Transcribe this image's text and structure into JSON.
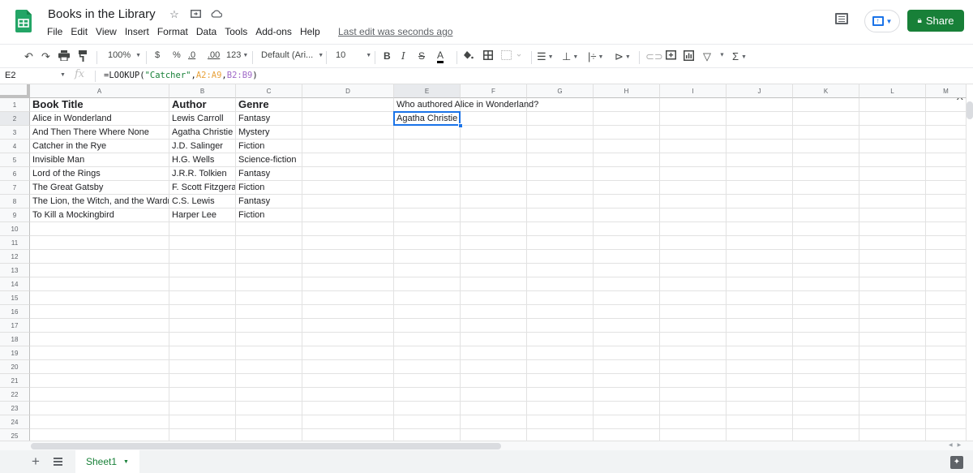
{
  "app": {
    "title": "Books in the Library",
    "last_edit": "Last edit was seconds ago",
    "share_label": "Share",
    "title_icons": [
      "star-icon",
      "move-to-folder-icon",
      "cloud-status-icon"
    ]
  },
  "menu": [
    "File",
    "Edit",
    "View",
    "Insert",
    "Format",
    "Data",
    "Tools",
    "Add-ons",
    "Help"
  ],
  "toolbar": {
    "zoom": "100%",
    "currency": "$",
    "percent": "%",
    "decrease_decimal": ".0",
    "increase_decimal": ".00",
    "more_formats": "123",
    "font": "Default (Ari...",
    "font_size": "10",
    "bold": "B",
    "italic": "I",
    "strike": "S",
    "text_color": "A"
  },
  "formula_bar": {
    "name_box": "E2",
    "fx": "fx",
    "formula_prefix": "=LOOKUP(",
    "formula_string": "\"Catcher\"",
    "formula_comma1": ",",
    "formula_range1": "A2:A9",
    "formula_comma2": ",",
    "formula_range2": "B2:B9",
    "formula_suffix": ")"
  },
  "columns": [
    "A",
    "B",
    "C",
    "D",
    "E",
    "F",
    "G",
    "H",
    "I",
    "J",
    "K",
    "L",
    "M"
  ],
  "selected_column": "E",
  "selected_row": 2,
  "rows": [
    "1",
    "2",
    "3",
    "4",
    "5",
    "6",
    "7",
    "8",
    "9",
    "10",
    "11",
    "12",
    "13",
    "14",
    "15",
    "16",
    "17",
    "18",
    "19",
    "20",
    "21",
    "22",
    "23",
    "24",
    "25"
  ],
  "table": {
    "headers": [
      "Book Title",
      "Author",
      "Genre"
    ],
    "data": [
      [
        "Alice in Wonderland",
        "Lewis Carroll",
        "Fantasy"
      ],
      [
        "And Then There Where None",
        "Agatha Christie",
        "Mystery"
      ],
      [
        "Catcher in the Rye",
        "J.D. Salinger",
        "Fiction"
      ],
      [
        "Invisible Man",
        "H.G. Wells",
        "Science-fiction"
      ],
      [
        "Lord of the Rings",
        "J.R.R. Tolkien",
        "Fantasy"
      ],
      [
        "The Great Gatsby",
        "F. Scott Fitzgera",
        "Fiction"
      ],
      [
        "The Lion, the Witch, and the Wardro",
        "C.S. Lewis",
        "Fantasy"
      ],
      [
        "To Kill a Mockingbird",
        "Harper Lee",
        "Fiction"
      ]
    ]
  },
  "question_cell": {
    "ref": "E1",
    "value": "Who authored Alice in Wonderland?"
  },
  "answer_cell": {
    "ref": "E2",
    "value": "Agatha Christie"
  },
  "sheets": [
    {
      "name": "Sheet1",
      "active": true
    }
  ],
  "colors": {
    "brand_green": "#188038",
    "selection_blue": "#1a73e8"
  }
}
